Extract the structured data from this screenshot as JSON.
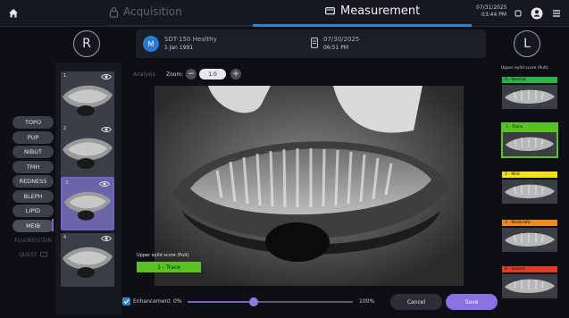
{
  "header": {
    "acquisition_label": "Acquisition",
    "measurement_label": "Measurement",
    "date": "07/31/2025",
    "time": "03:44 PM",
    "icons": [
      "home-icon",
      "lock-icon",
      "monitor-icon",
      "dot-icon",
      "user-icon",
      "menu-icon"
    ]
  },
  "eyes": {
    "right": "R",
    "left": "L"
  },
  "patient": {
    "initial": "M",
    "name": "SDT-150 Healthy",
    "dob": "1 Jan 1991",
    "session_date": "07/30/2025",
    "session_time": "06:51 PM"
  },
  "nav": [
    "TOPO",
    "PUP",
    "NIBUT",
    "TMH",
    "REDNESS",
    "BLEPH",
    "LIPID",
    "MEIB",
    "FLUORESCEIN",
    "QUEST"
  ],
  "nav_active": "MEIB",
  "thumbnails": [
    {
      "num": "1",
      "selected": false
    },
    {
      "num": "2",
      "selected": false
    },
    {
      "num": "3",
      "selected": true
    },
    {
      "num": "4",
      "selected": false
    }
  ],
  "toolbar": {
    "analysis_label": "Analysis",
    "zoom_label": "Zoom:",
    "zoom_value": "1.0",
    "minus": "−",
    "plus": "+"
  },
  "score": {
    "label": "Upper eylid score (Pult)",
    "value": "1 - Trace"
  },
  "bottom": {
    "enhancement_label": "Enhancement",
    "min": "0%",
    "max": "100%",
    "enhancement_fraction": 0.4,
    "cancel": "Cancel",
    "save": "Save"
  },
  "reference": {
    "title": "Upper eylid score (Pult)",
    "grades": [
      {
        "label": "0 - Normal",
        "color": "#2fb24a",
        "selected": false
      },
      {
        "label": "1 - Trace",
        "color": "#58c322",
        "selected": true
      },
      {
        "label": "2 - Mild",
        "color": "#f2e019",
        "selected": false
      },
      {
        "label": "3 - Moderate",
        "color": "#f08a1c",
        "selected": false
      },
      {
        "label": "4 - Severe",
        "color": "#e23a2a",
        "selected": false
      }
    ]
  }
}
